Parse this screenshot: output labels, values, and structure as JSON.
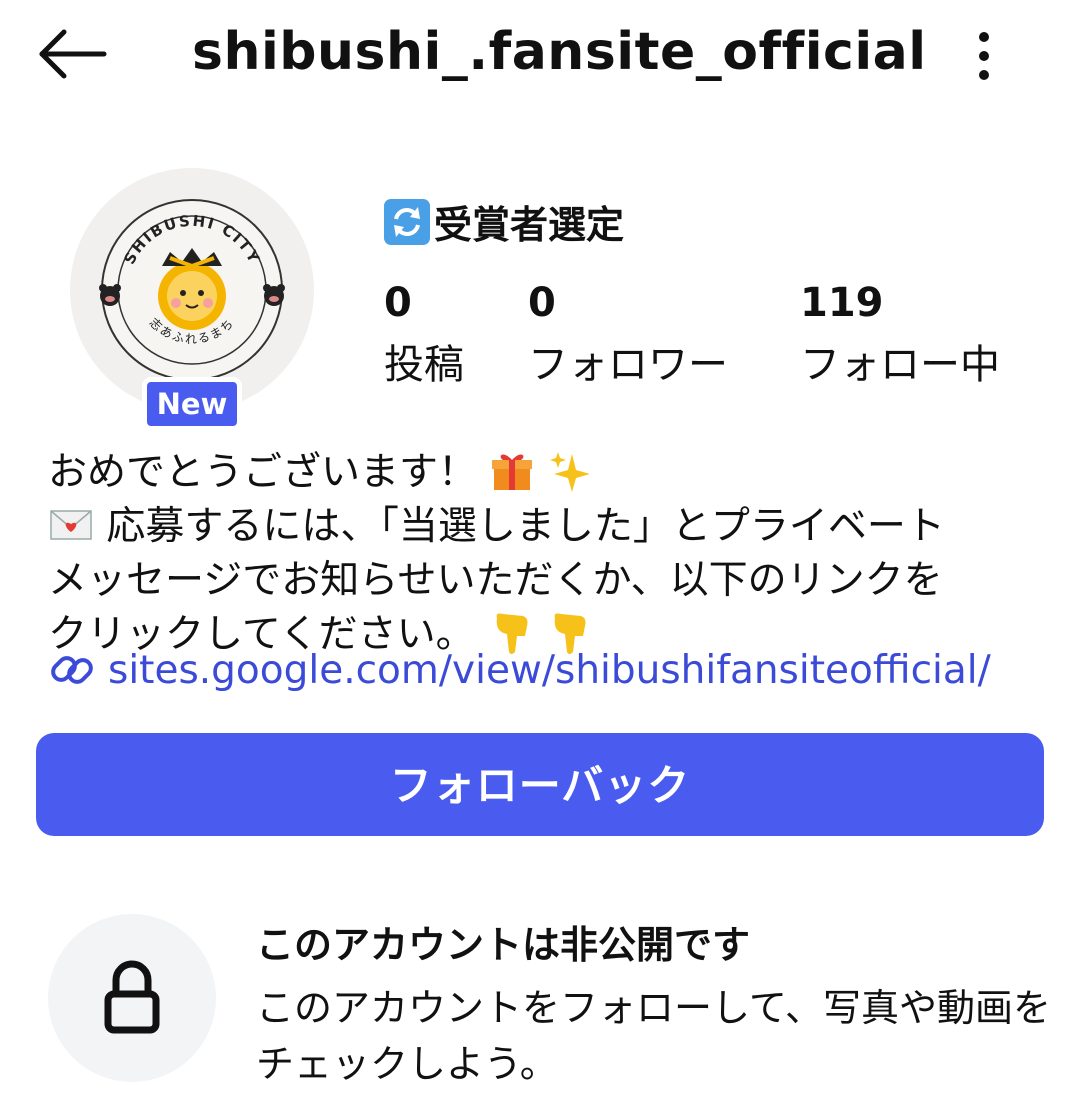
{
  "header": {
    "username": "shibushi_.fansite_official",
    "back_icon": "back-arrow-icon",
    "more_icon": "more-vertical-icon"
  },
  "profile": {
    "avatar_text_top": "SHIBUSHI CITY",
    "avatar_text_bottom": "志あふれるまち",
    "new_badge": "New",
    "display_name_emoji": "refresh-arrows-emoji",
    "display_name": "受賞者選定",
    "stats": [
      {
        "value": "0",
        "label": "投稿"
      },
      {
        "value": "0",
        "label": "フォロワー"
      },
      {
        "value": "119",
        "label": "フォロー中"
      }
    ]
  },
  "bio": {
    "line1": "おめでとうございます！",
    "line2": "応募するには、「当選しました」とプライベート",
    "line3": "メッセージでお知らせいただくか、以下のリンクを",
    "line4": "クリックしてください。",
    "link": "sites.google.com/view/shibushifansiteofficial/"
  },
  "actions": {
    "follow_back_label": "フォローバック"
  },
  "private_notice": {
    "title": "このアカウントは非公開です",
    "description": "このアカウントをフォローして、写真や動画をチェックしよう。",
    "icon": "lock-icon"
  },
  "colors": {
    "accent": "#4a5cf0",
    "link": "#3b4bd8",
    "text": "#111111"
  }
}
